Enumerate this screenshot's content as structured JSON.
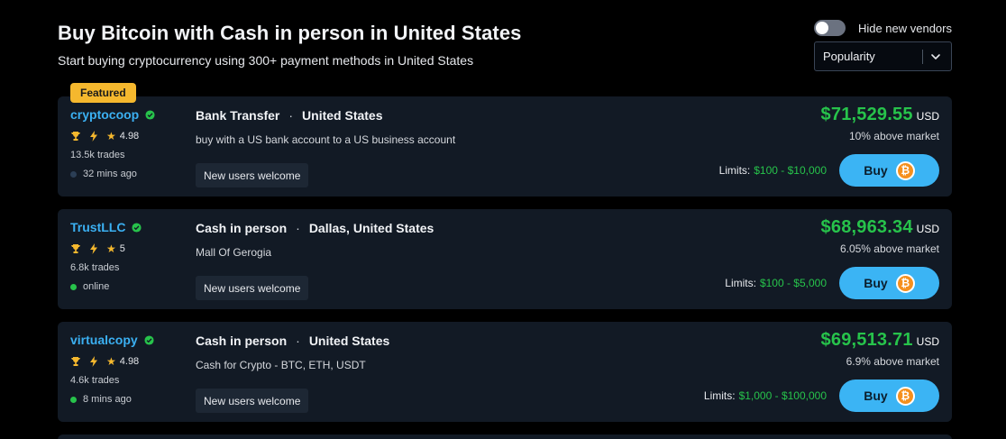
{
  "header": {
    "title": "Buy Bitcoin with Cash in person in United States",
    "subtitle": "Start buying cryptocurrency using 300+ payment methods in United States"
  },
  "controls": {
    "hide_new_vendors_label": "Hide new vendors",
    "hide_new_vendors_on": false,
    "sort_value": "Popularity"
  },
  "featured_label": "Featured",
  "buy_label": "Buy",
  "btc_symbol": "₿",
  "limits_label": "Limits:",
  "colors": {
    "accent": "#3bb4f4",
    "price_green": "#27c34b",
    "featured": "#f5b82e",
    "card_bg": "#121a25"
  },
  "offers": [
    {
      "vendor": "cryptocoop",
      "rating": "4.98",
      "trades": "13.5k trades",
      "status": "32 mins ago",
      "status_color": "#2b3e55",
      "payment_method": "Bank Transfer",
      "location": "United States",
      "description": "buy with a US bank account to a US business account",
      "tag": "New users welcome",
      "price": "$71,529.55",
      "currency": "USD",
      "market": "10% above market",
      "limits": "$100 - $10,000"
    },
    {
      "vendor": "TrustLLC",
      "rating": "5",
      "trades": "6.8k trades",
      "status": "online",
      "status_color": "#27c34b",
      "payment_method": "Cash in person",
      "location": "Dallas, United States",
      "description": "Mall Of Gerogia",
      "tag": "New users welcome",
      "price": "$68,963.34",
      "currency": "USD",
      "market": "6.05% above market",
      "limits": "$100 - $5,000"
    },
    {
      "vendor": "virtualcopy",
      "rating": "4.98",
      "trades": "4.6k trades",
      "status": "8 mins ago",
      "status_color": "#27c34b",
      "payment_method": "Cash in person",
      "location": "United States",
      "description": "Cash for Crypto - BTC, ETH, USDT",
      "tag": "New users welcome",
      "price": "$69,513.71",
      "currency": "USD",
      "market": "6.9% above market",
      "limits": "$1,000 - $100,000"
    }
  ]
}
